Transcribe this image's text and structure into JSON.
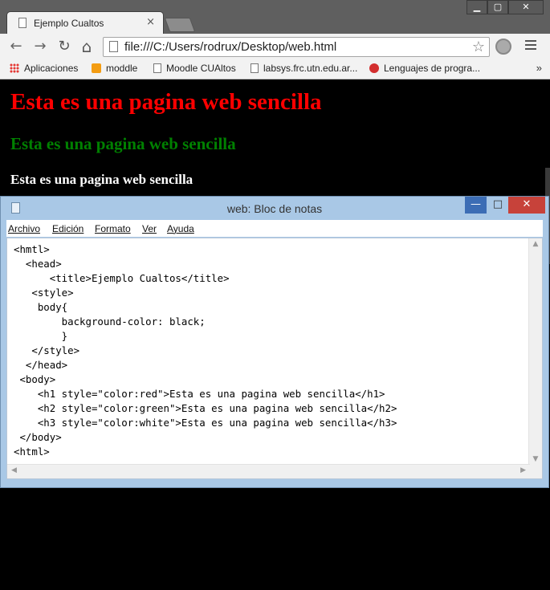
{
  "browser": {
    "tab_title": "Ejemplo Cualtos",
    "tab_close": "×",
    "window_min": "▁",
    "window_max": "▢",
    "window_close": "✕",
    "nav_back": "←",
    "nav_forward": "→",
    "nav_reload": "↻",
    "nav_home": "⌂",
    "url": "file:///C:/Users/rodrux/Desktop/web.html",
    "star": "☆",
    "bookmarks": [
      {
        "label": "Aplicaciones",
        "icon": "apps-grid-icon"
      },
      {
        "label": "moddle",
        "icon": "moodle-icon"
      },
      {
        "label": "Moodle CUAltos",
        "icon": "page-icon"
      },
      {
        "label": "labsys.frc.utn.edu.ar...",
        "icon": "page-icon"
      },
      {
        "label": "Lenguajes de progra...",
        "icon": "quora-icon"
      }
    ],
    "bookmarks_more": "»"
  },
  "page": {
    "h1": "Esta es una pagina web sencilla",
    "h2": "Esta es una pagina web sencilla",
    "h3": "Esta es una pagina web sencilla"
  },
  "notepad": {
    "title": "web: Bloc de notas",
    "btn_min": "—",
    "btn_max": "□",
    "btn_close": "✕",
    "menu": [
      "Archivo",
      "Edición",
      "Formato",
      "Ver",
      "Ayuda"
    ],
    "content": "<hmtl>\n  <head>\n      <title>Ejemplo Cualtos</title>\n   <style>\n    body{\n        background-color: black;\n        }\n   </style>\n  </head>\n <body>\n    <h1 style=\"color:red\">Esta es una pagina web sencilla</h1>\n    <h2 style=\"color:green\">Esta es una pagina web sencilla</h2>\n    <h3 style=\"color:white\">Esta es una pagina web sencilla</h3>\n </body>\n<html>"
  }
}
